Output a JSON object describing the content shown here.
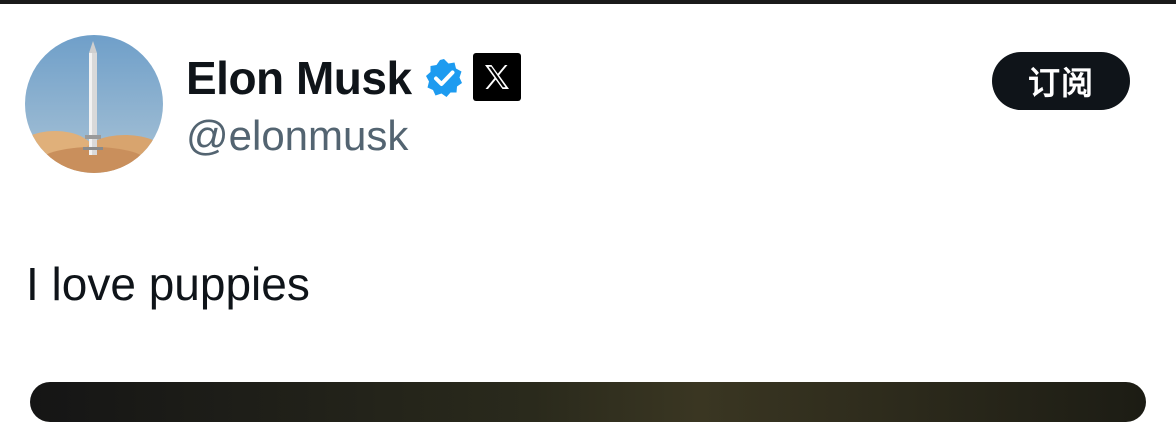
{
  "post": {
    "author": {
      "display_name": "Elon Musk",
      "handle": "@elonmusk",
      "avatar_icon": "rocket-launch-avatar",
      "verified_icon": "verified-badge-icon",
      "verified_color": "#1d9bf0",
      "affiliation_icon": "x-logo-icon"
    },
    "subscribe_label": "订阅",
    "text": "I love puppies"
  },
  "colors": {
    "text_primary": "#0f1419",
    "text_secondary": "#536471",
    "button_bg": "#0f1419",
    "button_text": "#ffffff"
  }
}
